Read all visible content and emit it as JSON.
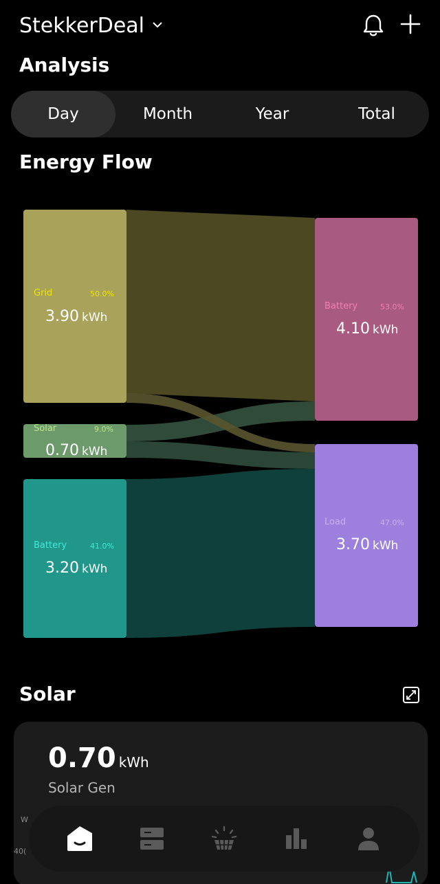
{
  "header": {
    "site_name": "StekkerDeal",
    "notifications_icon": "bell-icon",
    "add_icon": "plus-icon"
  },
  "analysis": {
    "title": "Analysis",
    "tabs": [
      {
        "label": "Day",
        "active": true
      },
      {
        "label": "Month",
        "active": false
      },
      {
        "label": "Year",
        "active": false
      },
      {
        "label": "Total",
        "active": false
      }
    ]
  },
  "energy_flow": {
    "title": "Energy Flow",
    "sources": [
      {
        "name": "Grid",
        "percent": "50.0%",
        "value": "3.90",
        "unit": "kWh",
        "color": "#a8a25a",
        "label_color": "#f0e600"
      },
      {
        "name": "Solar",
        "percent": "9.0%",
        "value": "0.70",
        "unit": "kWh",
        "color": "#6d9a6a",
        "label_color": "#b9e48a"
      },
      {
        "name": "Battery",
        "percent": "41.0%",
        "value": "3.20",
        "unit": "kWh",
        "color": "#21968a",
        "label_color": "#42e9d6"
      }
    ],
    "targets": [
      {
        "name": "Battery",
        "percent": "53.0%",
        "value": "4.10",
        "unit": "kWh",
        "color": "#a85a80",
        "label_color": "#f07fb3"
      },
      {
        "name": "Load",
        "percent": "47.0%",
        "value": "3.70",
        "unit": "kWh",
        "color": "#9d80de",
        "label_color": "#c5b0f0"
      }
    ]
  },
  "solar": {
    "title": "Solar",
    "expand_icon": "expand-icon",
    "value": "0.70",
    "unit": "kWh",
    "label": "Solar Gen",
    "axis_unit_partial": "W",
    "axis_tick_partial": "40("
  },
  "bottom_nav": [
    {
      "name": "home",
      "icon": "home-icon",
      "active": true
    },
    {
      "name": "devices",
      "icon": "devices-icon",
      "active": false
    },
    {
      "name": "solar",
      "icon": "solar-panel-icon",
      "active": false
    },
    {
      "name": "analysis",
      "icon": "bar-chart-icon",
      "active": false
    },
    {
      "name": "profile",
      "icon": "user-icon",
      "active": false
    }
  ]
}
